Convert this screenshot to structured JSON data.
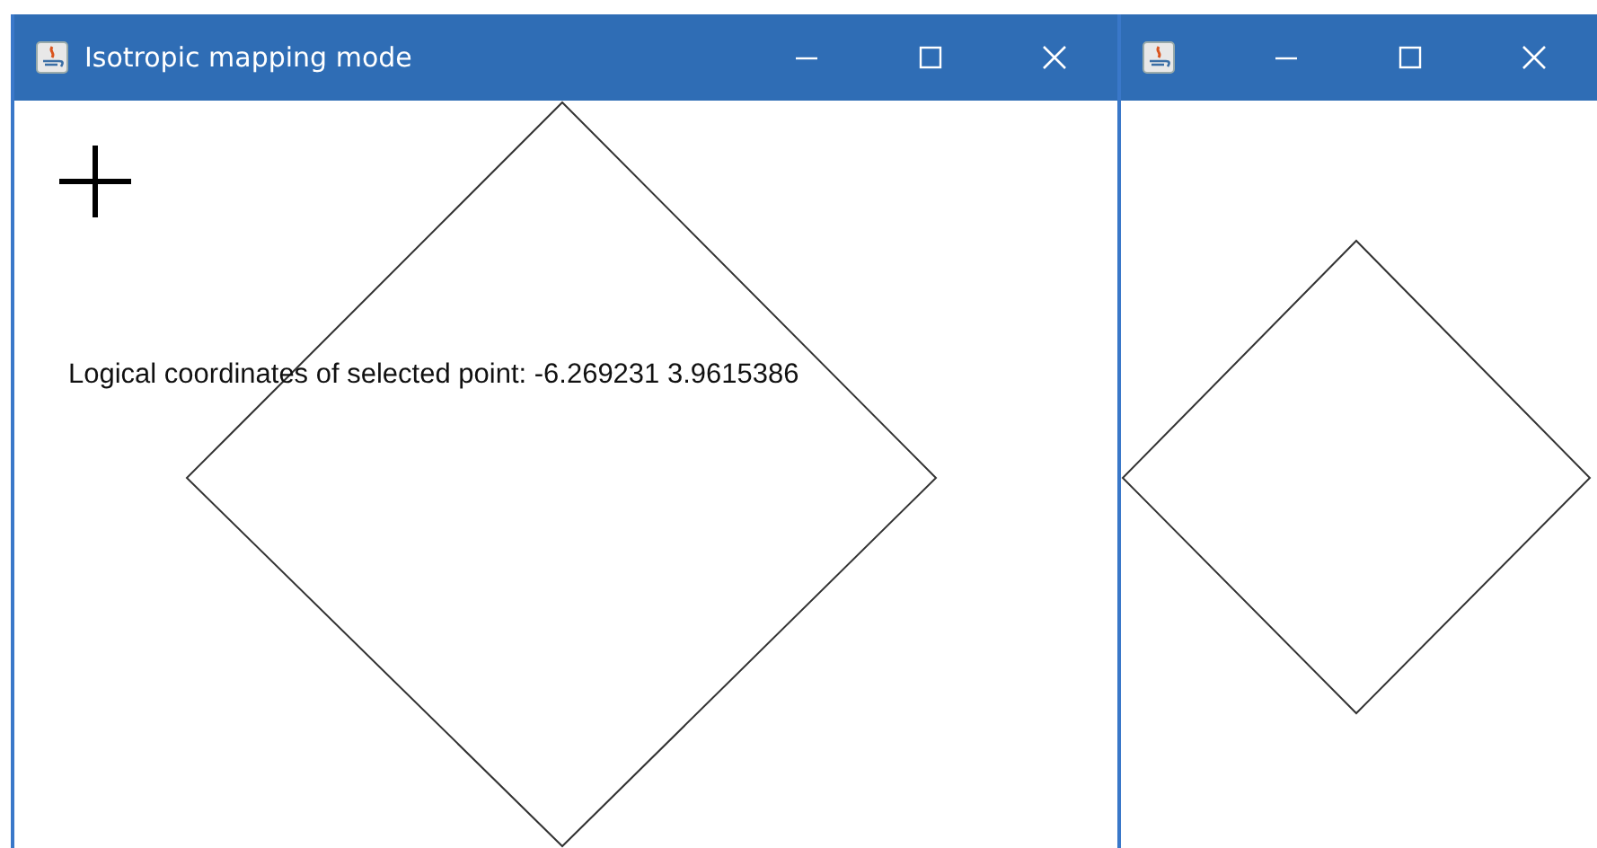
{
  "windows": [
    {
      "title": "Isotropic mapping mode",
      "readout": "Logical coordinates of selected point: -6.269231 3.9615386",
      "crosshair": true
    },
    {
      "crosshair": false
    }
  ]
}
